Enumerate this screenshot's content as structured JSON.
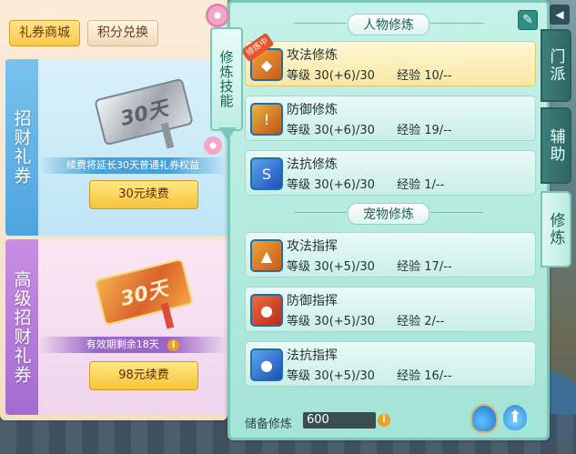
{
  "shop": {
    "tabs": [
      {
        "label": "礼券商城",
        "active": true
      },
      {
        "label": "积分兑换",
        "active": false
      }
    ],
    "cards": [
      {
        "vertical_label": "招财礼券",
        "ticket_text": "30天",
        "info_text": "续费将延长30天普通礼券权益",
        "button_label": "30元续费"
      },
      {
        "vertical_label": "高级招财礼券",
        "ticket_text": "30天",
        "info_text": "有效期剩余18天",
        "info_icon": "i",
        "button_label": "98元续费"
      }
    ]
  },
  "skill_tab": {
    "label": "修炼技能"
  },
  "main": {
    "sections": [
      {
        "title": "人物修炼",
        "skills": [
          {
            "name": "攻法修炼",
            "level_label": "等级",
            "level": "30(+6)/30",
            "exp_label": "经验",
            "exp": "10/--",
            "badge": "修炼中",
            "active": true,
            "icon": "attack-magic-icon"
          },
          {
            "name": "防御修炼",
            "level_label": "等级",
            "level": "30(+6)/30",
            "exp_label": "经验",
            "exp": "19/--",
            "active": false,
            "icon": "defense-icon"
          },
          {
            "name": "法抗修炼",
            "level_label": "等级",
            "level": "30(+6)/30",
            "exp_label": "经验",
            "exp": "1/--",
            "active": false,
            "icon": "magic-resist-icon"
          }
        ]
      },
      {
        "title": "宠物修炼",
        "skills": [
          {
            "name": "攻法指挥",
            "level_label": "等级",
            "level": "30(+5)/30",
            "exp_label": "经验",
            "exp": "17/--",
            "active": false,
            "icon": "pet-attack-icon"
          },
          {
            "name": "防御指挥",
            "level_label": "等级",
            "level": "30(+5)/30",
            "exp_label": "经验",
            "exp": "2/--",
            "active": false,
            "icon": "pet-defense-icon"
          },
          {
            "name": "法抗指挥",
            "level_label": "等级",
            "level": "30(+5)/30",
            "exp_label": "经验",
            "exp": "16/--",
            "active": false,
            "icon": "pet-resist-icon"
          }
        ]
      }
    ],
    "reserve": {
      "label": "储备修炼",
      "value": "600",
      "info_icon": "i"
    }
  },
  "right_tabs": [
    {
      "label": "门派",
      "active": false
    },
    {
      "label": "辅助",
      "active": false
    },
    {
      "label": "修炼",
      "active": true
    }
  ],
  "icons": {
    "collapse": "◀",
    "edit": "✎",
    "upgrade": "⬆"
  }
}
